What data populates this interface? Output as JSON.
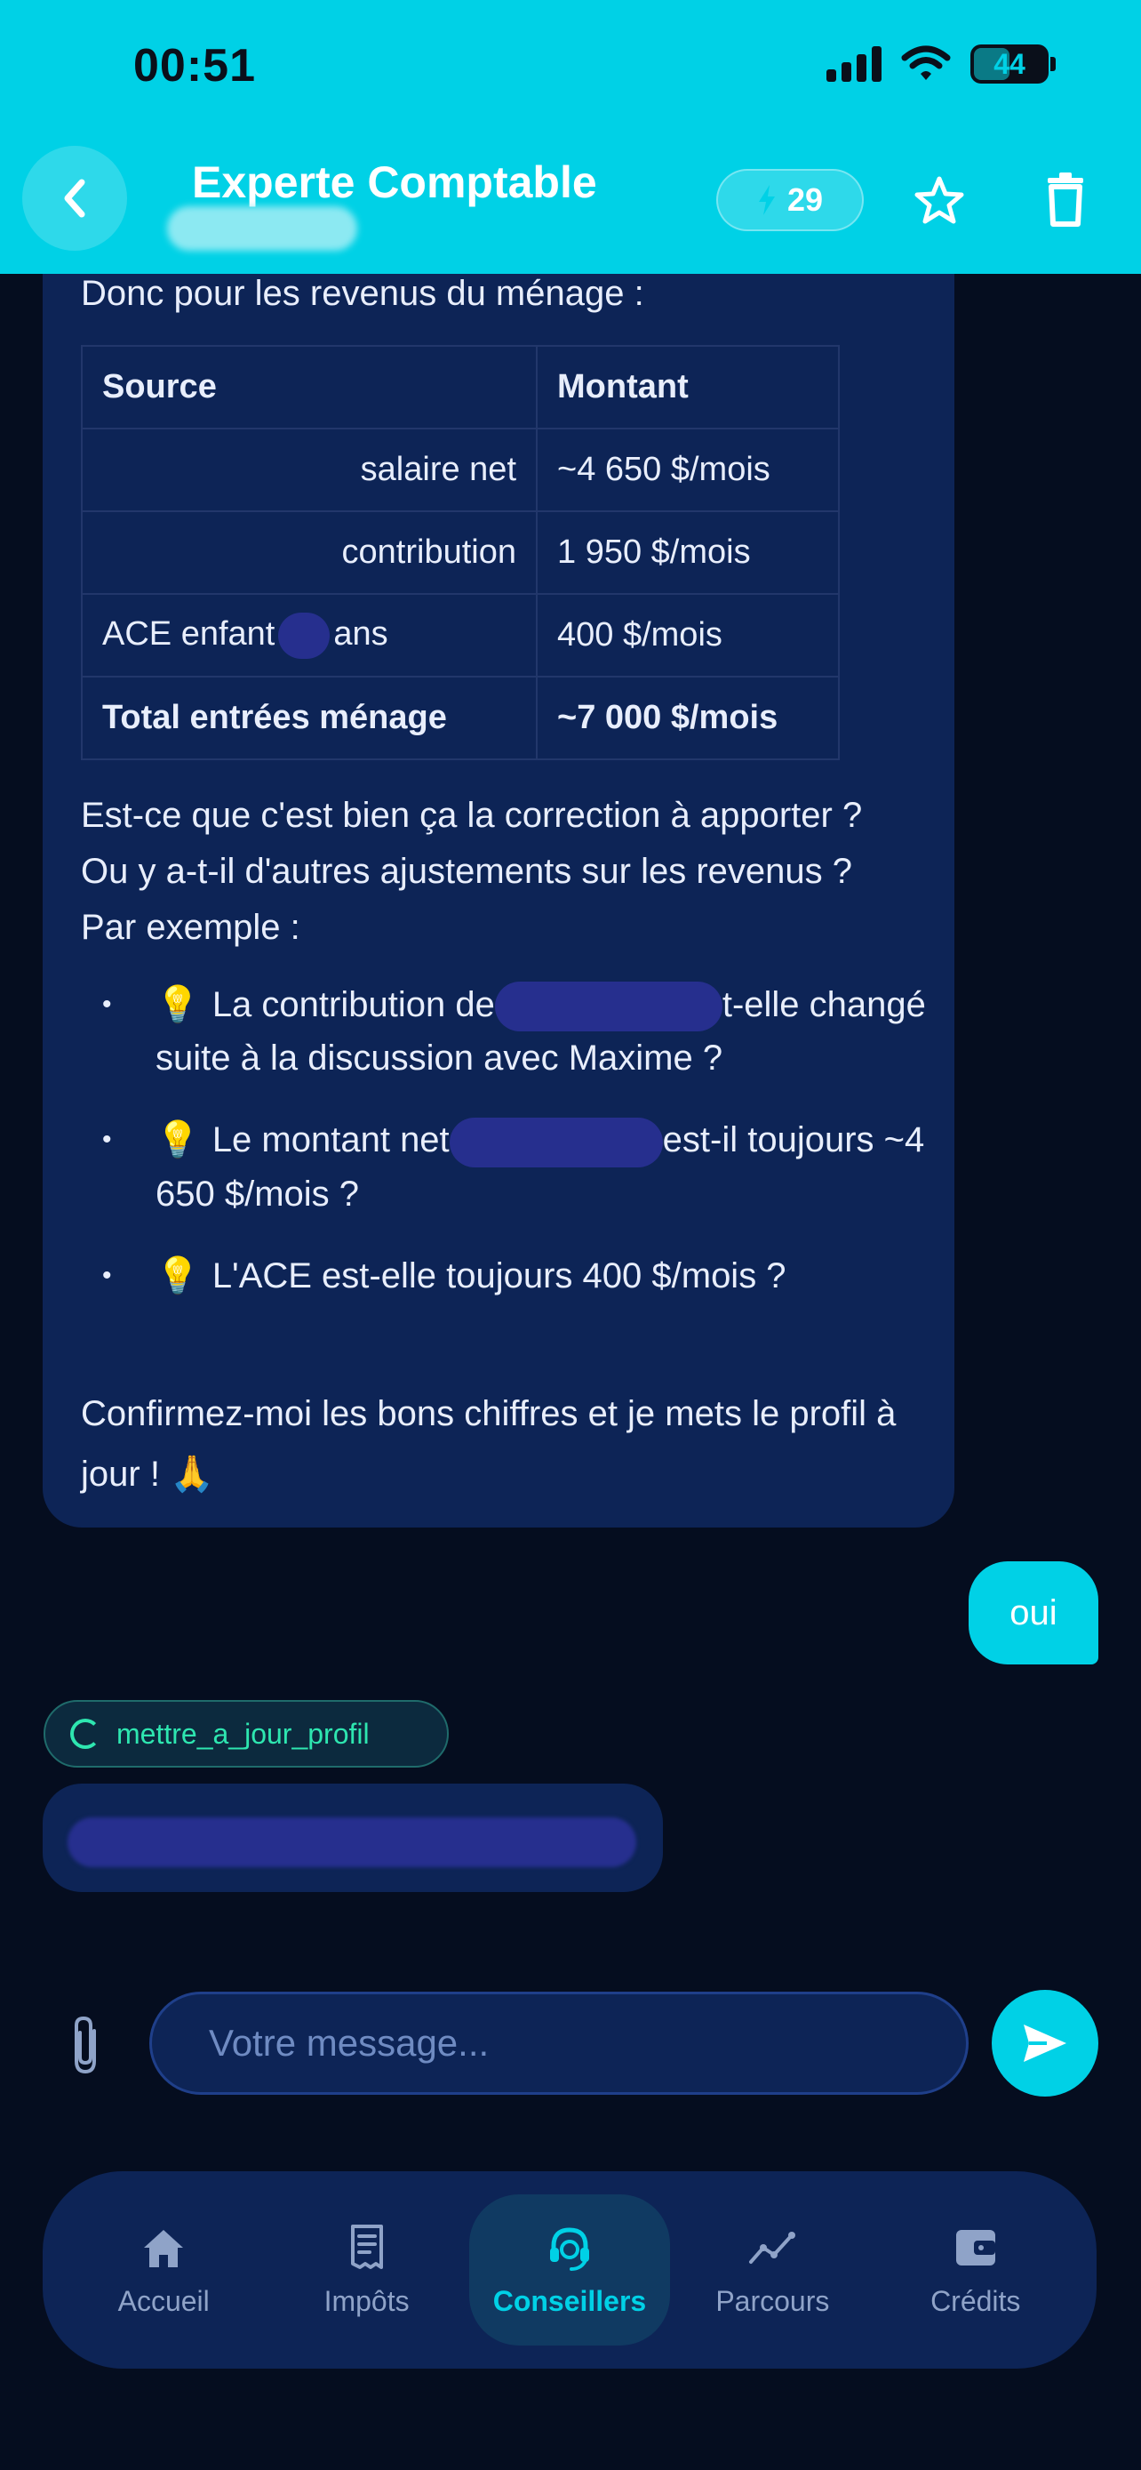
{
  "status_bar": {
    "time": "00:51",
    "battery": "44"
  },
  "header": {
    "title": "Experte Comptable",
    "credits": "29"
  },
  "message_ai": {
    "intro": "Donc pour les revenus du ménage :",
    "table": {
      "headers": [
        "Source",
        "Montant"
      ],
      "rows": [
        {
          "source": "salaire net",
          "amount": "~4 650 $/mois"
        },
        {
          "source": "contribution",
          "amount": "1 950 $/mois"
        },
        {
          "source_a": "ACE enfant",
          "source_b": "ans",
          "amount": "400 $/mois"
        }
      ],
      "total": {
        "source": "Total entrées ménage",
        "amount": "~7 000 $/mois"
      }
    },
    "question": "Est-ce que c'est bien ça la correction à apporter ? Ou y a-t-il d'autres ajustements sur les revenus ? Par exemple :",
    "bullets": [
      {
        "a": "La contribution de",
        "b": "t-elle changé suite à la discussion avec Maxime ?"
      },
      {
        "a": "Le montant net",
        "b": "est-il toujours ~4 650 $/mois ?"
      },
      {
        "a": "L'ACE est-elle toujours 400 $/mois ?"
      }
    ],
    "bullet_icon": "lightbulb-emoji",
    "closing": "Confirmez-moi les bons chiffres et je mets le profil à jour ! 🙏"
  },
  "message_user": {
    "text": "oui"
  },
  "tool_call": {
    "label": "mettre_a_jour_profil"
  },
  "composer": {
    "placeholder": "Votre message..."
  },
  "bottom_nav": {
    "items": [
      {
        "label": "Accueil",
        "icon": "home-icon"
      },
      {
        "label": "Impôts",
        "icon": "receipt-icon"
      },
      {
        "label": "Conseillers",
        "icon": "headset-icon",
        "active": true
      },
      {
        "label": "Parcours",
        "icon": "chart-line-icon"
      },
      {
        "label": "Crédits",
        "icon": "wallet-icon"
      }
    ]
  },
  "colors": {
    "accent": "#00d1e6",
    "background": "#050d1f",
    "bubble": "#0d2456",
    "tool_green": "#2ee6b0"
  }
}
